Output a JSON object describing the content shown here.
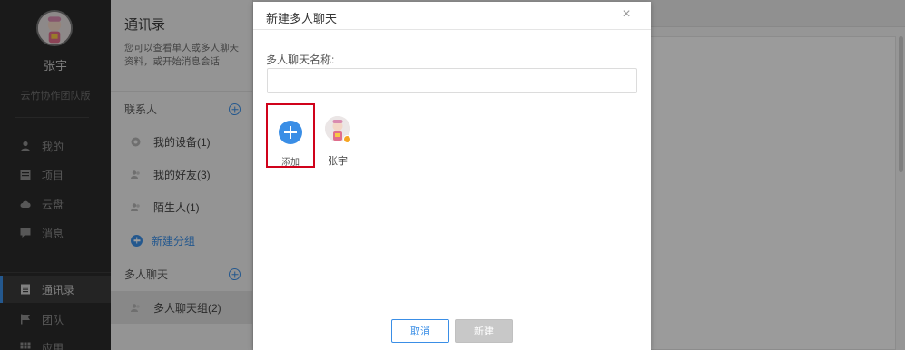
{
  "sidebar": {
    "user_name": "张宇",
    "team_name": "云竹协作团队版",
    "items": [
      {
        "label": "我的",
        "icon": "user-icon"
      },
      {
        "label": "项目",
        "icon": "project-icon"
      },
      {
        "label": "云盘",
        "icon": "cloud-icon"
      },
      {
        "label": "消息",
        "icon": "message-icon"
      },
      {
        "label": "通讯录",
        "icon": "contacts-icon"
      },
      {
        "label": "团队",
        "icon": "flag-icon"
      },
      {
        "label": "应用",
        "icon": "apps-icon"
      }
    ]
  },
  "contacts": {
    "title": "通讯录",
    "description": "您可以查看单人或多人聊天资料，或开始消息会话",
    "contacts_header": "联系人",
    "items": [
      {
        "label": "我的设备(1)",
        "icon": "device-icon"
      },
      {
        "label": "我的好友(3)",
        "icon": "friends-icon"
      },
      {
        "label": "陌生人(1)",
        "icon": "stranger-icon"
      }
    ],
    "new_group_label": "新建分组",
    "group_chat_header": "多人聊天",
    "group_chats": [
      {
        "label": "多人聊天组(2)",
        "icon": "group-icon"
      }
    ]
  },
  "modal": {
    "title": "新建多人聊天",
    "close_icon": "close-icon",
    "name_label": "多人聊天名称:",
    "name_value": "",
    "add_label": "添加",
    "members": [
      {
        "name": "张宇",
        "is_admin": true
      }
    ],
    "cancel_label": "取消",
    "create_label": "新建"
  },
  "colors": {
    "accent": "#3a8ee6",
    "highlight_box": "#d0021b",
    "sidebar_bg": "#2b2b2b",
    "disabled_button": "#c8c8c8"
  }
}
